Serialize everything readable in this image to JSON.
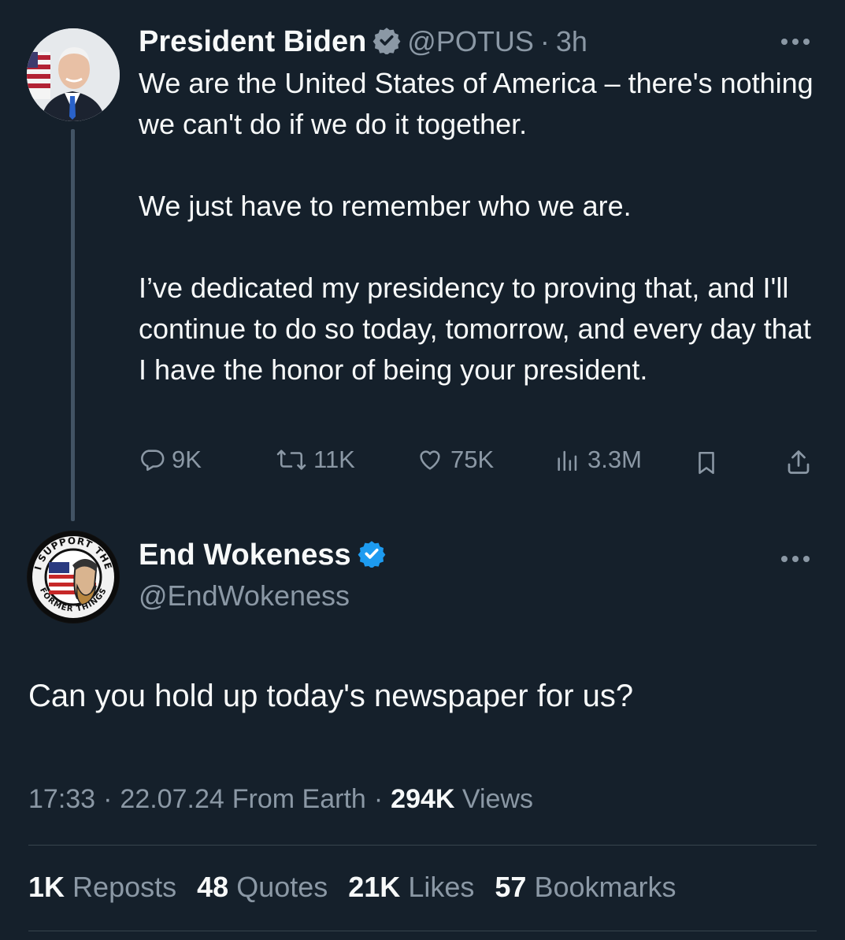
{
  "tweet1": {
    "name": "President Biden",
    "handle": "@POTUS",
    "separator": "·",
    "time": "3h",
    "paragraphs": [
      "We are the United States of America – there's nothing we can't do if we do it together.",
      "We just have to remember who we are.",
      "I’ve dedicated my presidency to proving that, and I'll continue to do so today, tomorrow, and every day that I have the honor of being your president."
    ],
    "actions": {
      "replies": "9K",
      "reposts": "11K",
      "likes": "75K",
      "views": "3.3M"
    },
    "icons": [
      "reply-icon",
      "repost-icon",
      "like-icon",
      "views-icon",
      "bookmark-icon",
      "share-icon"
    ]
  },
  "tweet2": {
    "name": "End Wokeness",
    "handle": "@EndWokeness",
    "avatar_text_top": "I SUPPORT THE",
    "avatar_text_bottom": "FORMER THINGS",
    "text": "Can you hold up today's newspaper for us?",
    "meta": {
      "time": "17:33",
      "date": "22.07.24",
      "source": "From Earth",
      "views_count": "294K",
      "views_label": "Views",
      "sep": "·"
    },
    "stats": [
      {
        "num": "1K",
        "label": "Reposts"
      },
      {
        "num": "48",
        "label": "Quotes"
      },
      {
        "num": "21K",
        "label": "Likes"
      },
      {
        "num": "57",
        "label": "Bookmarks"
      }
    ]
  },
  "colors": {
    "background": "#15202b",
    "text": "#f7f9f9",
    "muted": "#8b98a5",
    "verified": "#1d9bf0",
    "divider": "#38444d"
  }
}
